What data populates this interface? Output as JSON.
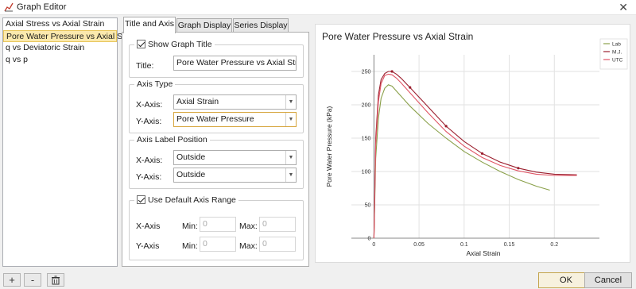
{
  "window": {
    "title": "Graph Editor",
    "close_glyph": "✕"
  },
  "graph_list": {
    "items": [
      {
        "label": "Axial Stress vs Axial Strain",
        "selected": false
      },
      {
        "label": "Pore Water Pressure vs Axial Strain",
        "selected": true
      },
      {
        "label": "q vs Deviatoric Strain",
        "selected": false
      },
      {
        "label": "q vs p",
        "selected": false
      }
    ]
  },
  "tabs": [
    {
      "label": "Title and Axis",
      "active": true
    },
    {
      "label": "Graph Display",
      "active": false
    },
    {
      "label": "Series Display",
      "active": false
    }
  ],
  "title_group": {
    "checkbox_label": "Show Graph Title",
    "checked": true,
    "title_label": "Title:",
    "title_value": "Pore Water Pressure vs Axial Strain"
  },
  "axis_type": {
    "legend": "Axis Type",
    "x_label": "X-Axis:",
    "x_value": "Axial Strain",
    "y_label": "Y-Axis:",
    "y_value": "Pore Water Pressure"
  },
  "axis_label_position": {
    "legend": "Axis Label Position",
    "x_label": "X-Axis:",
    "x_value": "Outside",
    "y_label": "Y-Axis:",
    "y_value": "Outside"
  },
  "axis_range": {
    "checkbox_label": "Use Default Axis Range",
    "checked": true,
    "x_label": "X-Axis",
    "y_label": "Y-Axis",
    "min_label": "Min:",
    "max_label": "Max:",
    "x_min": "0",
    "x_max": "0",
    "y_min": "0",
    "y_max": "0"
  },
  "bottom_toolbar": {
    "add": "+",
    "remove": "-",
    "delete_icon": "trash-icon"
  },
  "buttons": {
    "ok": "OK",
    "cancel": "Cancel"
  },
  "chart_data": {
    "type": "line",
    "title": "Pore Water Pressure vs Axial Strain",
    "xlabel": "Axial Strain",
    "ylabel": "Pore Water Pressure (kPa)",
    "xlim": [
      -0.025,
      0.25
    ],
    "ylim": [
      0,
      275
    ],
    "x_ticks": [
      "0",
      "0.05",
      "0.1",
      "0.15",
      "0.2"
    ],
    "y_ticks": [
      "0",
      "50",
      "100",
      "150",
      "200",
      "250"
    ],
    "x_tick_values": [
      0,
      0.05,
      0.1,
      0.15,
      0.2
    ],
    "y_tick_values": [
      0,
      50,
      100,
      150,
      200,
      250
    ],
    "grid": true,
    "legend_position": "top-right",
    "series": [
      {
        "name": "Lab",
        "color": "#8aa04a",
        "marker": false,
        "x": [
          0,
          0.002,
          0.005,
          0.008,
          0.012,
          0.016,
          0.02,
          0.03,
          0.04,
          0.06,
          0.08,
          0.1,
          0.12,
          0.14,
          0.16,
          0.18,
          0.195
        ],
        "y": [
          0,
          120,
          180,
          210,
          225,
          230,
          228,
          213,
          198,
          172,
          150,
          130,
          114,
          100,
          88,
          78,
          72
        ]
      },
      {
        "name": "M.J.",
        "color": "#9b1f2e",
        "marker": true,
        "x": [
          0,
          0.002,
          0.005,
          0.008,
          0.012,
          0.016,
          0.02,
          0.025,
          0.03,
          0.04,
          0.06,
          0.08,
          0.1,
          0.12,
          0.14,
          0.16,
          0.18,
          0.2,
          0.225
        ],
        "y": [
          0,
          150,
          215,
          238,
          247,
          250,
          250,
          246,
          240,
          226,
          197,
          168,
          145,
          127,
          114,
          105,
          99,
          96,
          95
        ],
        "marker_x": [
          0.02,
          0.04,
          0.08,
          0.12,
          0.16
        ],
        "marker_y": [
          250,
          226,
          168,
          127,
          105
        ]
      },
      {
        "name": "UTC",
        "color": "#e05565",
        "marker": false,
        "x": [
          0,
          0.002,
          0.005,
          0.008,
          0.012,
          0.016,
          0.02,
          0.025,
          0.03,
          0.04,
          0.06,
          0.08,
          0.1,
          0.12,
          0.14,
          0.16,
          0.18,
          0.2,
          0.225
        ],
        "y": [
          0,
          140,
          205,
          232,
          244,
          246,
          245,
          240,
          233,
          218,
          188,
          160,
          138,
          121,
          109,
          101,
          96,
          94,
          94
        ]
      }
    ]
  }
}
